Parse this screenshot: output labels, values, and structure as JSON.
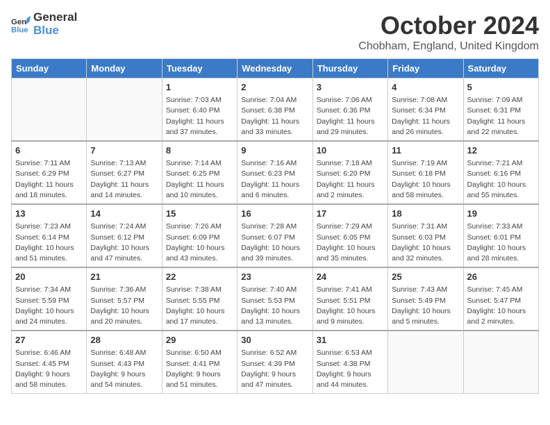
{
  "logo": {
    "line1": "General",
    "line2": "Blue"
  },
  "title": "October 2024",
  "subtitle": "Chobham, England, United Kingdom",
  "days_of_week": [
    "Sunday",
    "Monday",
    "Tuesday",
    "Wednesday",
    "Thursday",
    "Friday",
    "Saturday"
  ],
  "weeks": [
    [
      {
        "day": null
      },
      {
        "day": null
      },
      {
        "day": "1",
        "sunrise": "Sunrise: 7:03 AM",
        "sunset": "Sunset: 6:40 PM",
        "daylight": "Daylight: 11 hours and 37 minutes."
      },
      {
        "day": "2",
        "sunrise": "Sunrise: 7:04 AM",
        "sunset": "Sunset: 6:38 PM",
        "daylight": "Daylight: 11 hours and 33 minutes."
      },
      {
        "day": "3",
        "sunrise": "Sunrise: 7:06 AM",
        "sunset": "Sunset: 6:36 PM",
        "daylight": "Daylight: 11 hours and 29 minutes."
      },
      {
        "day": "4",
        "sunrise": "Sunrise: 7:08 AM",
        "sunset": "Sunset: 6:34 PM",
        "daylight": "Daylight: 11 hours and 26 minutes."
      },
      {
        "day": "5",
        "sunrise": "Sunrise: 7:09 AM",
        "sunset": "Sunset: 6:31 PM",
        "daylight": "Daylight: 11 hours and 22 minutes."
      }
    ],
    [
      {
        "day": "6",
        "sunrise": "Sunrise: 7:11 AM",
        "sunset": "Sunset: 6:29 PM",
        "daylight": "Daylight: 11 hours and 18 minutes."
      },
      {
        "day": "7",
        "sunrise": "Sunrise: 7:13 AM",
        "sunset": "Sunset: 6:27 PM",
        "daylight": "Daylight: 11 hours and 14 minutes."
      },
      {
        "day": "8",
        "sunrise": "Sunrise: 7:14 AM",
        "sunset": "Sunset: 6:25 PM",
        "daylight": "Daylight: 11 hours and 10 minutes."
      },
      {
        "day": "9",
        "sunrise": "Sunrise: 7:16 AM",
        "sunset": "Sunset: 6:23 PM",
        "daylight": "Daylight: 11 hours and 6 minutes."
      },
      {
        "day": "10",
        "sunrise": "Sunrise: 7:18 AM",
        "sunset": "Sunset: 6:20 PM",
        "daylight": "Daylight: 11 hours and 2 minutes."
      },
      {
        "day": "11",
        "sunrise": "Sunrise: 7:19 AM",
        "sunset": "Sunset: 6:18 PM",
        "daylight": "Daylight: 10 hours and 58 minutes."
      },
      {
        "day": "12",
        "sunrise": "Sunrise: 7:21 AM",
        "sunset": "Sunset: 6:16 PM",
        "daylight": "Daylight: 10 hours and 55 minutes."
      }
    ],
    [
      {
        "day": "13",
        "sunrise": "Sunrise: 7:23 AM",
        "sunset": "Sunset: 6:14 PM",
        "daylight": "Daylight: 10 hours and 51 minutes."
      },
      {
        "day": "14",
        "sunrise": "Sunrise: 7:24 AM",
        "sunset": "Sunset: 6:12 PM",
        "daylight": "Daylight: 10 hours and 47 minutes."
      },
      {
        "day": "15",
        "sunrise": "Sunrise: 7:26 AM",
        "sunset": "Sunset: 6:09 PM",
        "daylight": "Daylight: 10 hours and 43 minutes."
      },
      {
        "day": "16",
        "sunrise": "Sunrise: 7:28 AM",
        "sunset": "Sunset: 6:07 PM",
        "daylight": "Daylight: 10 hours and 39 minutes."
      },
      {
        "day": "17",
        "sunrise": "Sunrise: 7:29 AM",
        "sunset": "Sunset: 6:05 PM",
        "daylight": "Daylight: 10 hours and 35 minutes."
      },
      {
        "day": "18",
        "sunrise": "Sunrise: 7:31 AM",
        "sunset": "Sunset: 6:03 PM",
        "daylight": "Daylight: 10 hours and 32 minutes."
      },
      {
        "day": "19",
        "sunrise": "Sunrise: 7:33 AM",
        "sunset": "Sunset: 6:01 PM",
        "daylight": "Daylight: 10 hours and 28 minutes."
      }
    ],
    [
      {
        "day": "20",
        "sunrise": "Sunrise: 7:34 AM",
        "sunset": "Sunset: 5:59 PM",
        "daylight": "Daylight: 10 hours and 24 minutes."
      },
      {
        "day": "21",
        "sunrise": "Sunrise: 7:36 AM",
        "sunset": "Sunset: 5:57 PM",
        "daylight": "Daylight: 10 hours and 20 minutes."
      },
      {
        "day": "22",
        "sunrise": "Sunrise: 7:38 AM",
        "sunset": "Sunset: 5:55 PM",
        "daylight": "Daylight: 10 hours and 17 minutes."
      },
      {
        "day": "23",
        "sunrise": "Sunrise: 7:40 AM",
        "sunset": "Sunset: 5:53 PM",
        "daylight": "Daylight: 10 hours and 13 minutes."
      },
      {
        "day": "24",
        "sunrise": "Sunrise: 7:41 AM",
        "sunset": "Sunset: 5:51 PM",
        "daylight": "Daylight: 10 hours and 9 minutes."
      },
      {
        "day": "25",
        "sunrise": "Sunrise: 7:43 AM",
        "sunset": "Sunset: 5:49 PM",
        "daylight": "Daylight: 10 hours and 5 minutes."
      },
      {
        "day": "26",
        "sunrise": "Sunrise: 7:45 AM",
        "sunset": "Sunset: 5:47 PM",
        "daylight": "Daylight: 10 hours and 2 minutes."
      }
    ],
    [
      {
        "day": "27",
        "sunrise": "Sunrise: 6:46 AM",
        "sunset": "Sunset: 4:45 PM",
        "daylight": "Daylight: 9 hours and 58 minutes."
      },
      {
        "day": "28",
        "sunrise": "Sunrise: 6:48 AM",
        "sunset": "Sunset: 4:43 PM",
        "daylight": "Daylight: 9 hours and 54 minutes."
      },
      {
        "day": "29",
        "sunrise": "Sunrise: 6:50 AM",
        "sunset": "Sunset: 4:41 PM",
        "daylight": "Daylight: 9 hours and 51 minutes."
      },
      {
        "day": "30",
        "sunrise": "Sunrise: 6:52 AM",
        "sunset": "Sunset: 4:39 PM",
        "daylight": "Daylight: 9 hours and 47 minutes."
      },
      {
        "day": "31",
        "sunrise": "Sunrise: 6:53 AM",
        "sunset": "Sunset: 4:38 PM",
        "daylight": "Daylight: 9 hours and 44 minutes."
      },
      {
        "day": null
      },
      {
        "day": null
      }
    ]
  ]
}
